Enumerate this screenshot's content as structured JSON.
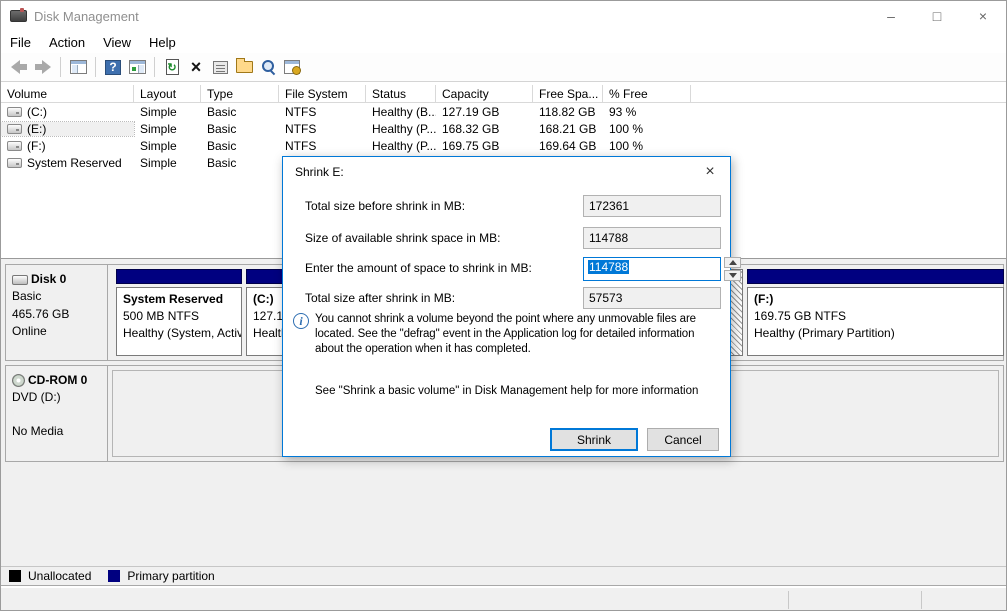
{
  "window": {
    "title": "Disk Management",
    "minimize": "–",
    "maximize": "□",
    "close": "×"
  },
  "menu": {
    "items": [
      "File",
      "Action",
      "View",
      "Help"
    ]
  },
  "toolbar": {
    "icons": [
      "back",
      "forward",
      "show-console-tree",
      "help",
      "show-action-pane",
      "refresh",
      "delete",
      "properties",
      "open",
      "find",
      "help-settings"
    ]
  },
  "volume_table": {
    "columns": [
      "Volume",
      "Layout",
      "Type",
      "File System",
      "Status",
      "Capacity",
      "Free Spa...",
      "% Free"
    ],
    "rows": [
      {
        "name": "(C:)",
        "layout": "Simple",
        "type": "Basic",
        "fs": "NTFS",
        "status": "Healthy (B...",
        "capacity": "127.19 GB",
        "free": "118.82 GB",
        "pct": "93 %"
      },
      {
        "name": "(E:)",
        "layout": "Simple",
        "type": "Basic",
        "fs": "NTFS",
        "status": "Healthy (P...",
        "capacity": "168.32 GB",
        "free": "168.21 GB",
        "pct": "100 %"
      },
      {
        "name": "(F:)",
        "layout": "Simple",
        "type": "Basic",
        "fs": "NTFS",
        "status": "Healthy (P...",
        "capacity": "169.75 GB",
        "free": "169.64 GB",
        "pct": "100 %"
      },
      {
        "name": "System Reserved",
        "layout": "Simple",
        "type": "Basic",
        "fs": "",
        "status": "",
        "capacity": "",
        "free": "",
        "pct": ""
      }
    ]
  },
  "disk0": {
    "title": "Disk 0",
    "line1": "Basic",
    "line2": "465.76 GB",
    "line3": "Online",
    "partitions": {
      "system_reserved": {
        "name": "System Reserved",
        "line2": "500 MB NTFS",
        "line3": "Healthy (System, Activ"
      },
      "c": {
        "name": "(C:)",
        "line2": "127.19",
        "line3": "Health"
      },
      "f": {
        "name": "(F:)",
        "line2": "169.75 GB NTFS",
        "line3": "Healthy (Primary Partition)"
      }
    }
  },
  "cdrom0": {
    "title": "CD-ROM 0",
    "line1": "DVD (D:)",
    "line3": "No Media"
  },
  "legend": {
    "unallocated": "Unallocated",
    "primary": "Primary partition"
  },
  "dialog": {
    "title": "Shrink E:",
    "close": "×",
    "fields": [
      {
        "label": "Total size before shrink in MB:",
        "value": "172361"
      },
      {
        "label": "Size of available shrink space in MB:",
        "value": "114788"
      },
      {
        "label": "Enter the amount of space to shrink in MB:",
        "value": "114788"
      },
      {
        "label": "Total size after shrink in MB:",
        "value": "57573"
      }
    ],
    "info_text": "You cannot shrink a volume beyond the point where any unmovable files are located. See the \"defrag\" event in the Application log for detailed information about the operation when it has completed.",
    "help_text": "See \"Shrink a basic volume\" in Disk Management help for more information",
    "shrink_button": "Shrink",
    "cancel_button": "Cancel"
  },
  "colors": {
    "accent": "#0078d7",
    "primary_partition": "#000080",
    "unallocated": "#000000"
  }
}
